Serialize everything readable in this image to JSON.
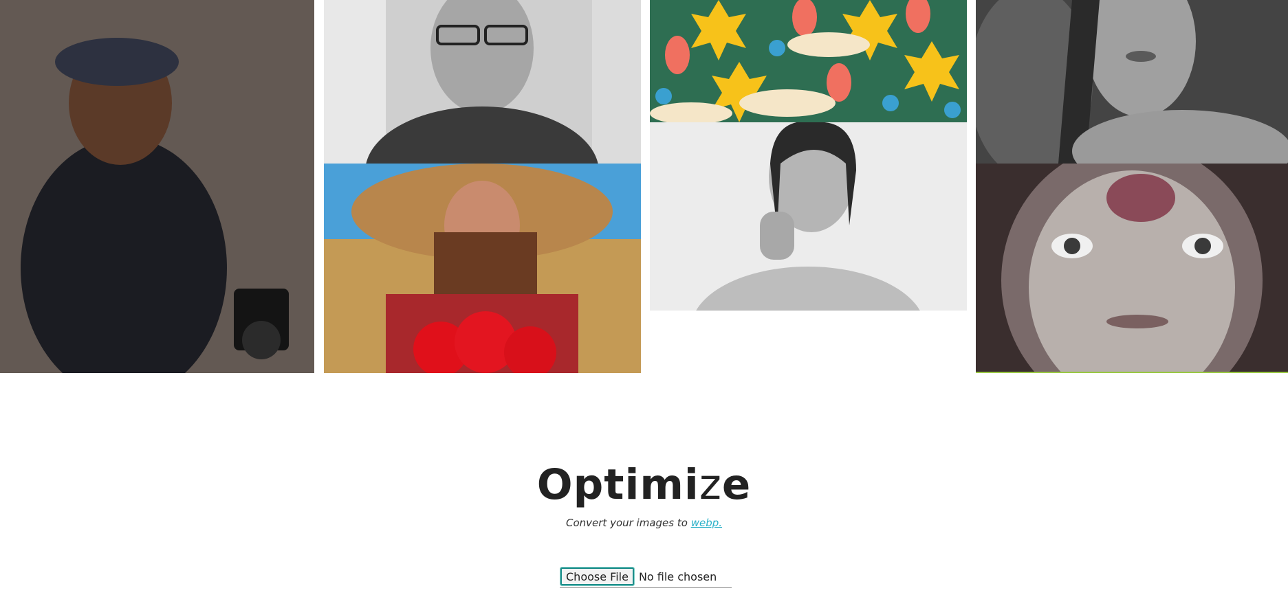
{
  "gallery": {
    "images": [
      {
        "alt": "man-in-beret-with-camera"
      },
      {
        "alt": "smiling-man-with-glasses"
      },
      {
        "alt": "woman-in-straw-hat-with-poppies"
      },
      {
        "alt": "colorful-pattern-art"
      },
      {
        "alt": "woman-portrait-grayscale"
      },
      {
        "alt": "woman-portrait-leaves"
      },
      {
        "alt": "child-portrait-grayscale"
      }
    ]
  },
  "hero": {
    "title_part1": "Optimi",
    "title_part2": "z",
    "title_part3": "e",
    "subtitle_text": "Convert your images to ",
    "subtitle_link": "webp."
  },
  "uploader": {
    "button_label": "Choose File",
    "status_text": "No file chosen"
  },
  "colors": {
    "accent": "#2ab0c8",
    "button_border": "#1e8d8a",
    "text": "#222222"
  }
}
